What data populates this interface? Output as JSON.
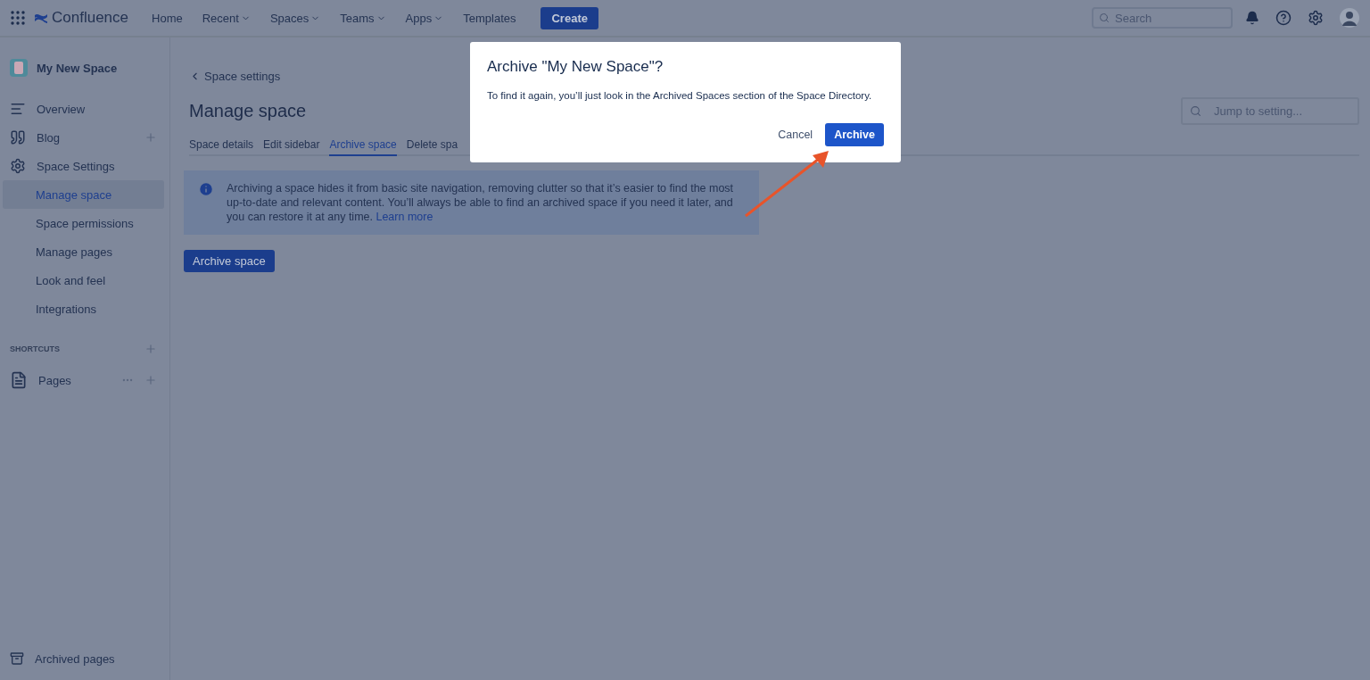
{
  "topbar": {
    "product": "Confluence",
    "nav": [
      {
        "label": "Home",
        "has_menu": false
      },
      {
        "label": "Recent",
        "has_menu": true
      },
      {
        "label": "Spaces",
        "has_menu": true
      },
      {
        "label": "Teams",
        "has_menu": true
      },
      {
        "label": "Apps",
        "has_menu": true
      },
      {
        "label": "Templates",
        "has_menu": false
      }
    ],
    "create": "Create",
    "search": {
      "placeholder": "Search"
    }
  },
  "sidebar": {
    "space_name": "My New Space",
    "items": [
      {
        "label": "Overview",
        "kind": "overview",
        "selected": false,
        "addable": false
      },
      {
        "label": "Blog",
        "kind": "blog",
        "selected": false,
        "addable": true
      },
      {
        "label": "Space Settings",
        "kind": "settings",
        "selected": false,
        "addable": false,
        "children": [
          {
            "label": "Manage space",
            "selected": true
          },
          {
            "label": "Space permissions",
            "selected": false
          },
          {
            "label": "Manage pages",
            "selected": false
          },
          {
            "label": "Look and feel",
            "selected": false
          },
          {
            "label": "Integrations",
            "selected": false
          }
        ]
      }
    ],
    "shortcuts_heading": "SHORTCUTS",
    "pages": "Pages",
    "archived": "Archived pages"
  },
  "main": {
    "back_link": "Space settings",
    "title": "Manage space",
    "jump": {
      "placeholder": "Jump to setting..."
    },
    "tabs": [
      {
        "label": "Space details",
        "selected": false
      },
      {
        "label": "Edit sidebar",
        "selected": false
      },
      {
        "label": "Archive space",
        "selected": true
      },
      {
        "label": "Delete spa",
        "selected": false
      }
    ],
    "info": {
      "text": "Archiving a space hides it from basic site navigation, removing clutter so that it’s easier to find the most up-to-date and relevant content. You’ll always be able to find an archived space if you need it later, and you can restore it at any time.",
      "link": "Learn more"
    },
    "button": "Archive space"
  },
  "dialog": {
    "title": "Archive \"My New Space\"?",
    "body": "To find it again, you’ll just look in the Archived Spaces section of the Space Directory.",
    "cancel": "Cancel",
    "confirm": "Archive"
  }
}
